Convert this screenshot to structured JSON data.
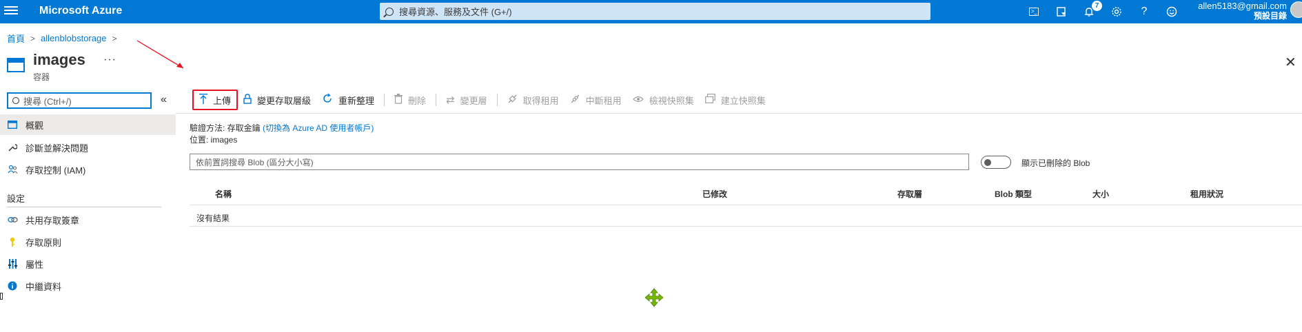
{
  "topbar": {
    "brand": "Microsoft Azure",
    "search_placeholder": "搜尋資源、服務及文件 (G+/)",
    "notifications_count": "7",
    "user_email": "allen5183@gmail.com",
    "user_directory": "預設目錄",
    "icons": [
      "cloud-shell-icon",
      "directory-filter-icon",
      "bell-icon",
      "gear-icon",
      "help-icon",
      "feedback-icon"
    ]
  },
  "breadcrumb": {
    "home": "首頁",
    "storage": "allenblobstorage"
  },
  "page": {
    "title": "images",
    "more": "···",
    "subtitle": "容器"
  },
  "nav": {
    "search_placeholder": "搜尋 (Ctrl+/)",
    "items": [
      {
        "label": "概觀",
        "icon": "container-icon"
      },
      {
        "label": "診斷並解決問題",
        "icon": "wrench-icon"
      },
      {
        "label": "存取控制 (IAM)",
        "icon": "people-icon"
      }
    ],
    "section_settings": "設定",
    "settings_items": [
      {
        "label": "共用存取簽章",
        "icon": "link-icon"
      },
      {
        "label": "存取原則",
        "icon": "key-icon"
      },
      {
        "label": "屬性",
        "icon": "properties-icon"
      },
      {
        "label": "中繼資料",
        "icon": "info-icon"
      }
    ]
  },
  "toolbar": {
    "upload": "上傳",
    "change_tier": "變更存取層級",
    "refresh": "重新整理",
    "delete": "刪除",
    "change_layer": "變更層",
    "acquire_lease": "取得租用",
    "break_lease": "中斷租用",
    "view_snapshots": "檢視快照集",
    "create_snapshot": "建立快照集"
  },
  "details": {
    "auth_label": "驗證方法: 存取金鑰",
    "auth_link": "(切換為 Azure AD 使用者帳戶)",
    "location": "位置: images"
  },
  "blob_search_placeholder": "依前置詞搜尋 Blob (區分大小寫)",
  "show_deleted_label": "顯示已刪除的 Blob",
  "table": {
    "headers": [
      "名稱",
      "已修改",
      "存取層",
      "Blob 類型",
      "大小",
      "租用狀況"
    ],
    "empty_text": "沒有結果"
  },
  "colors": {
    "azure_blue": "#0078d4",
    "highlight_red": "#e81123",
    "cursor_green": "#7ab800"
  }
}
